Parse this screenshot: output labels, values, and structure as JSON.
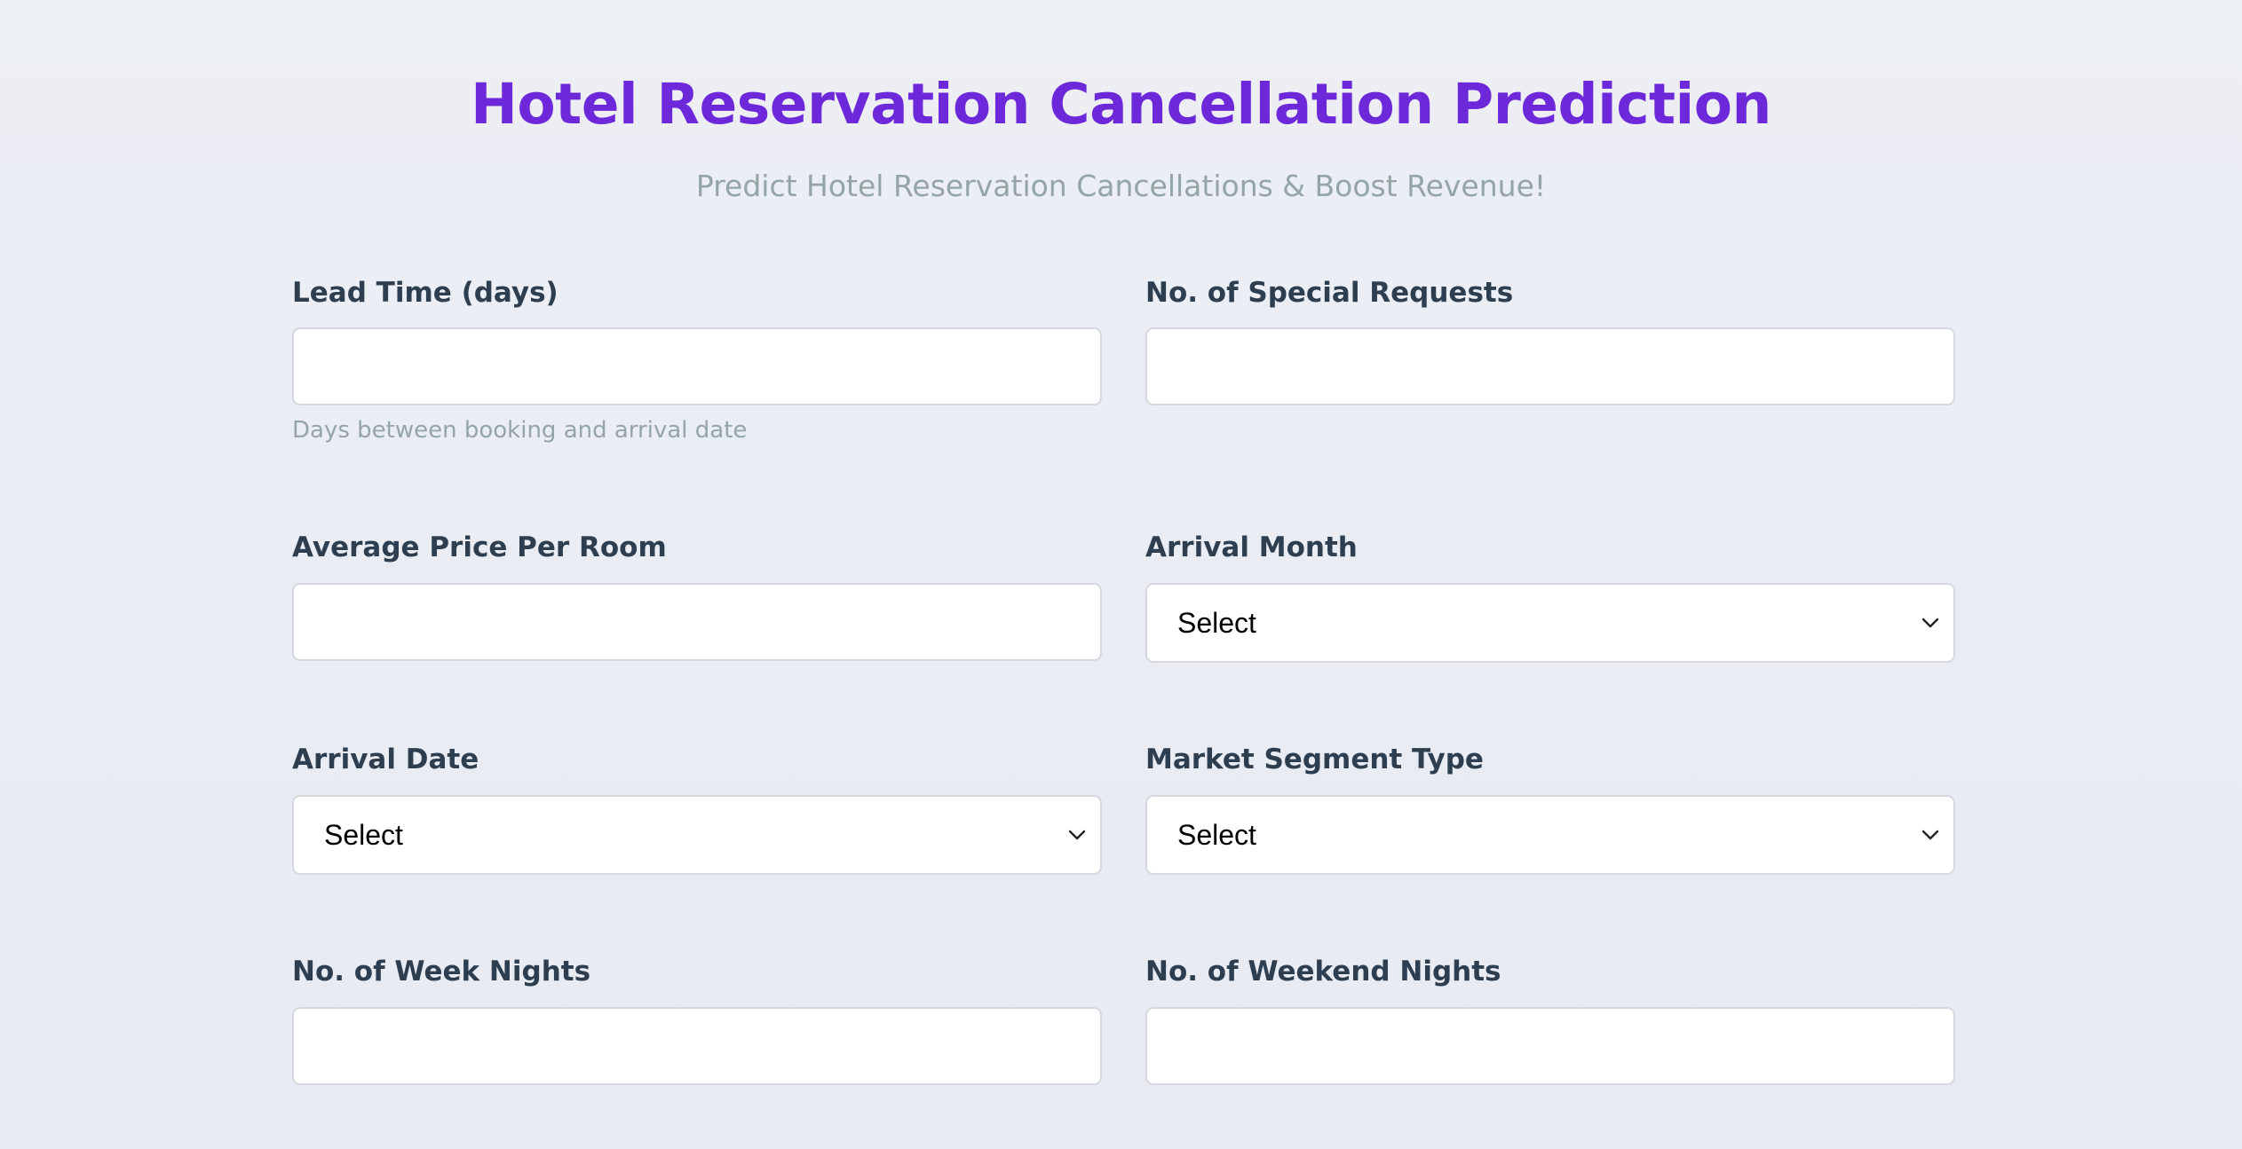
{
  "header": {
    "title": "Hotel Reservation Cancellation Prediction",
    "subtitle": "Predict Hotel Reservation Cancellations & Boost Revenue!"
  },
  "form": {
    "lead_time": {
      "label": "Lead Time (days)",
      "value": "",
      "help": "Days between booking and arrival date"
    },
    "special_requests": {
      "label": "No. of Special Requests",
      "value": ""
    },
    "avg_price": {
      "label": "Average Price Per Room",
      "value": ""
    },
    "arrival_month": {
      "label": "Arrival Month",
      "selected": "Select"
    },
    "arrival_date": {
      "label": "Arrival Date",
      "selected": "Select"
    },
    "market_segment": {
      "label": "Market Segment Type",
      "selected": "Select"
    },
    "week_nights": {
      "label": "No. of Week Nights",
      "value": ""
    },
    "weekend_nights": {
      "label": "No. of Weekend Nights",
      "value": ""
    }
  },
  "icons": {
    "select_arrow": "chevron-down-icon"
  },
  "colors": {
    "title": "#6d28d9",
    "label": "#2c3e50",
    "muted": "#95a5a6",
    "background": "#eceff4"
  }
}
